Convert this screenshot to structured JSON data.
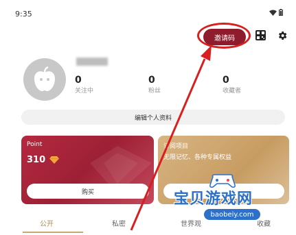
{
  "status_bar": {
    "time": "9:35",
    "wifi_icon": "wifi-icon",
    "battery_icon": "battery-icon"
  },
  "header": {
    "invite_label": "邀请码",
    "qr_icon": "qr-code-icon",
    "settings_icon": "gear-icon"
  },
  "profile": {
    "avatar_icon": "apple-avatar-icon",
    "stats": [
      {
        "value": "0",
        "label": "关注中"
      },
      {
        "value": "0",
        "label": "粉丝"
      },
      {
        "value": "0",
        "label": "收藏者"
      }
    ],
    "edit_label": "编辑个人资料"
  },
  "cards": {
    "point": {
      "title": "Point",
      "value": "310",
      "icon": "diamond-icon",
      "buy_label": "购买"
    },
    "vip": {
      "title": "订阅项目",
      "subtitle": "无限记忆、各种专属权益"
    }
  },
  "tabs": [
    {
      "label": "公开",
      "active": true
    },
    {
      "label": "私密",
      "active": false
    },
    {
      "label": "世界观",
      "active": false
    },
    {
      "label": "收藏",
      "active": false
    }
  ],
  "watermark": {
    "main": "宝贝游戏网",
    "sub": "baobeiy.com"
  },
  "colors": {
    "accent": "#8e1c2c",
    "annotation": "#d81e1e",
    "gold": "#c9a772"
  }
}
